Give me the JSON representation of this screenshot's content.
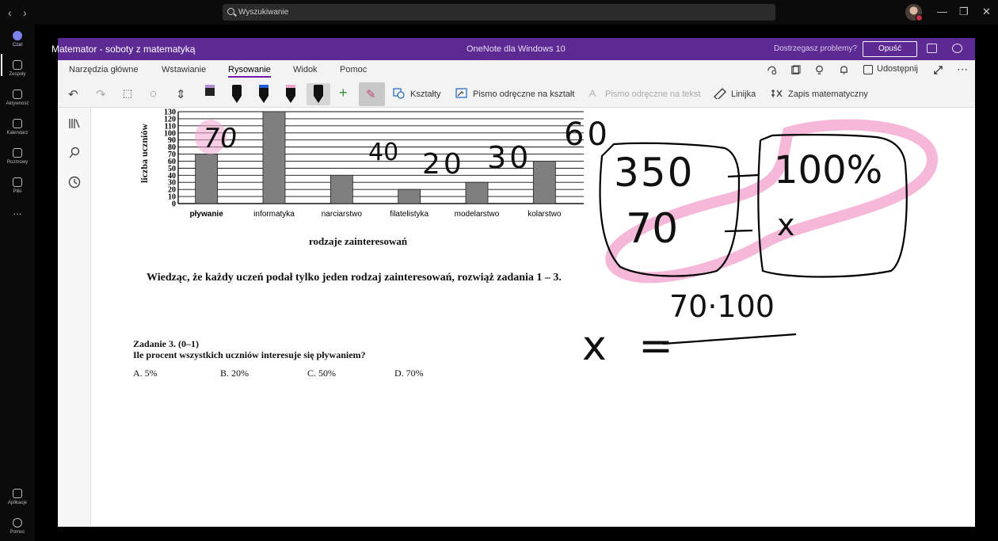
{
  "teams": {
    "search_placeholder": "Wyszukiwanie",
    "rail": [
      {
        "label": "Czat"
      },
      {
        "label": "Zespoły"
      },
      {
        "label": "Aktywność"
      },
      {
        "label": "Kalendarz"
      },
      {
        "label": "Rozmowy"
      },
      {
        "label": "Pliki"
      },
      {
        "label": "..."
      },
      {
        "label": "Aplikacje"
      },
      {
        "label": "Pomoc"
      }
    ]
  },
  "onenote": {
    "notebook_title": "Matemator - soboty z matematyką",
    "app_title": "OneNote dla Windows 10",
    "help_text": "Dostrzegasz problemy?",
    "leave_button": "Opuść",
    "menu_tabs": [
      "Narzędzia główne",
      "Wstawianie",
      "Rysowanie",
      "Widok",
      "Pomoc"
    ],
    "active_tab": "Rysowanie",
    "share_label": "Udostępnij",
    "toolbar": {
      "shapes": "Kształty",
      "ink_to_shape": "Pismo odręczne na kształt",
      "ink_to_text": "Pismo odręczne na tekst",
      "ruler": "Linijka",
      "math": "Zapis matematyczny"
    },
    "colors": {
      "title_bar": "#5c2a92",
      "accent": "#7719aa",
      "highlighter": "#f2a6cf"
    }
  },
  "page": {
    "chart": {
      "y_axis_label": "liczba uczniów",
      "x_axis_label": "rodzaje zainteresowań",
      "y_ticks": [
        "0",
        "10",
        "20",
        "30",
        "40",
        "50",
        "60",
        "70",
        "80",
        "90",
        "100",
        "110",
        "120",
        "130"
      ],
      "categories": [
        "pływanie",
        "informatyka",
        "narciarstwo",
        "filatelistyka",
        "modelarstwo",
        "kolarstwo"
      ]
    },
    "instruction": "Wiedząc, że każdy uczeń podał tylko jeden rodzaj zainteresowań, rozwiąż zadania 1 – 3.",
    "task_title": "Zadanie 3. (0–1)",
    "task_question": "Ile procent wszystkich uczniów interesuje się pływaniem?",
    "answers": [
      "A. 5%",
      "B. 20%",
      "C. 50%",
      "D. 70%"
    ],
    "handwriting": {
      "bar_notes": [
        "70",
        "40",
        "20",
        "30",
        "60"
      ],
      "proportion": [
        "350",
        "100%",
        "70",
        "x"
      ],
      "equation_lhs": "x =",
      "numerator": "70·100"
    }
  },
  "chart_data": {
    "type": "bar",
    "categories": [
      "pływanie",
      "informatyka",
      "narciarstwo",
      "filatelistyka",
      "modelarstwo",
      "kolarstwo"
    ],
    "values": [
      70,
      130,
      40,
      20,
      30,
      60
    ],
    "xlabel": "rodzaje zainteresowań",
    "ylabel": "liczba uczniów",
    "ylim": [
      0,
      130
    ],
    "grid": true
  }
}
